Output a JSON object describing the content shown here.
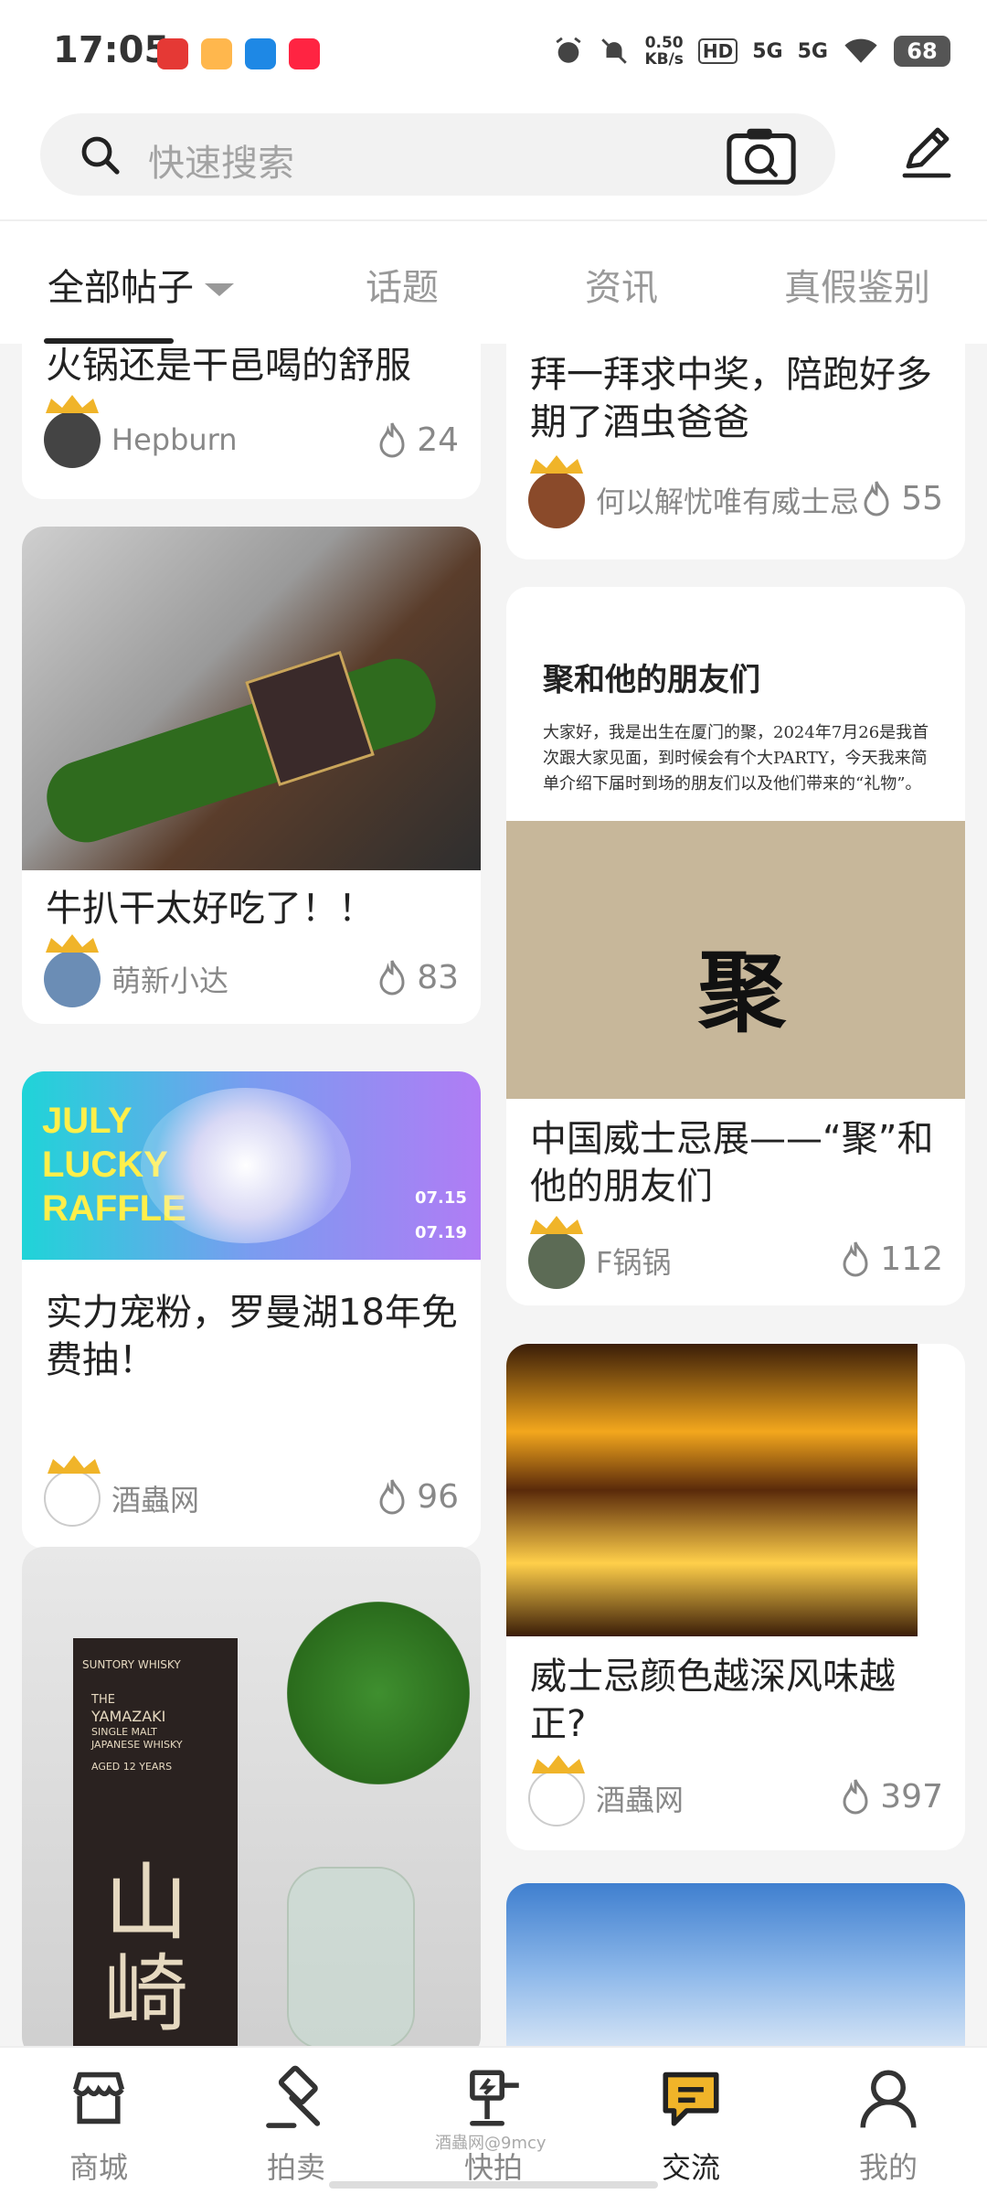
{
  "status_bar": {
    "time": "17:05",
    "net_speed_value": "0.50",
    "net_speed_unit": "KB/s",
    "hd_label": "HD",
    "signal1": "5G",
    "signal2": "5G",
    "battery": "68",
    "notif_icons": [
      "app-icon-red",
      "app-icon-orange",
      "app-icon-blue",
      "app-icon-xiaohongshu"
    ]
  },
  "search": {
    "placeholder": "快速搜索"
  },
  "tabs": [
    {
      "label": "全部帖子",
      "active": true
    },
    {
      "label": "话题",
      "active": false
    },
    {
      "label": "资讯",
      "active": false
    },
    {
      "label": "真假鉴别",
      "active": false
    }
  ],
  "feed": {
    "left": [
      {
        "title": "火锅还是干邑喝的舒服",
        "user": "Hepburn",
        "likes": "24",
        "image": "none"
      },
      {
        "title": "牛扒干太好吃了！！",
        "user": "萌新小达",
        "likes": "83",
        "image": "whisky-bottle-and-beef-jerky-photo"
      },
      {
        "title": "实力宠粉，罗曼湖18年免费抽！",
        "user": "酒蟲网",
        "likes": "96",
        "image": "july-lucky-raffle-banner",
        "banner": {
          "line1": "JULY",
          "line2": "LUCKY",
          "line3": "RAFFLE",
          "date_start": "07.15",
          "date_end": "07.19"
        }
      },
      {
        "title": "",
        "user": "",
        "likes": "",
        "image": "yamazaki-12-whisky-box-photo",
        "box": {
          "brand": "SUNTORY WHISKY",
          "name1": "THE",
          "name2": "YAMAZAKI",
          "name3": "SINGLE MALT",
          "name4": "JAPANESE WHISKY",
          "age": "AGED 12 YEARS",
          "kanji": "山崎"
        }
      }
    ],
    "right": [
      {
        "title": "拜一拜求中奖，陪跑好多期了酒虫爸爸",
        "user": "何以解忧唯有威士忌",
        "likes": "55",
        "image": "none"
      },
      {
        "title": "中国威士忌展——“聚”和他的朋友们",
        "user": "F锅锅",
        "likes": "112",
        "image": "whisky-expo-poster",
        "poster": {
          "heading": "聚和他的朋友们",
          "body": "大家好，我是出生在厦门的聚，2024年7月26是我首次跟大家见面，到时候会有个大PARTY，今天我来简单介绍下届时到场的朋友们以及他们带来的“礼物”。",
          "big_char": "聚"
        }
      },
      {
        "title": "威士忌颜色越深风味越正?",
        "user": "酒蟲网",
        "likes": "397",
        "image": "whisky-bottles-shelf-photo"
      },
      {
        "title": "",
        "user": "",
        "likes": "",
        "image": "sky-photo"
      }
    ]
  },
  "bottom_nav": [
    {
      "label": "商城",
      "icon": "shop-icon",
      "active": false
    },
    {
      "label": "拍卖",
      "icon": "gavel-icon",
      "active": false
    },
    {
      "label": "快拍",
      "icon": "quick-auction-icon",
      "active": false
    },
    {
      "label": "交流",
      "icon": "chat-icon",
      "active": true
    },
    {
      "label": "我的",
      "icon": "user-icon",
      "active": false
    }
  ],
  "watermark": "酒蟲网@9mcy",
  "colors": {
    "accent_gold": "#f0b429",
    "text_dark": "#222222",
    "text_muted": "#888888",
    "background": "#f4f4f4"
  }
}
